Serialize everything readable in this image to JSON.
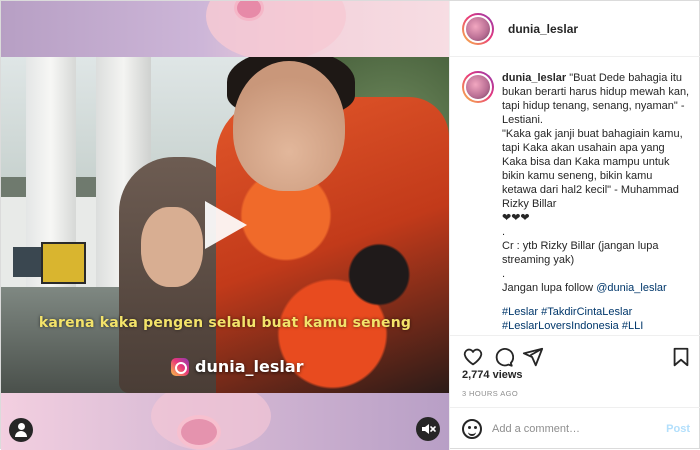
{
  "media": {
    "video_caption": "karena kaka pengen selalu buat kamu seneng",
    "watermark_handle": "dunia_leslar"
  },
  "header": {
    "username": "dunia_leslar"
  },
  "post": {
    "username": "dunia_leslar",
    "caption_lines": [
      "\"Buat Dede bahagia itu bukan berarti harus hidup mewah kan, tapi hidup tenang, senang, nyaman\" - Lestiani.",
      "\"Kaka gak janji buat bahagiain kamu, tapi Kaka akan usahain apa yang Kaka bisa dan Kaka mampu untuk bikin kamu seneng, bikin kamu ketawa dari hal2 kecil\" - Muhammad Rizky Billar",
      "❤❤❤",
      ".",
      "Cr : ytb Rizky Billar (jangan lupa streaming yak)",
      ".",
      "Jangan lupa follow"
    ],
    "mention": "@dunia_leslar",
    "hashtags": "#Leslar #TakdirCintaLeslar #LeslarLoversIndonesia #LLI #LeslarLovers #LestiBillar #LestyBillar #LeslarDansai #LeslarBerbagi #LestyK"
  },
  "stats": {
    "views": "2,774 views",
    "time_ago": "3 HOURS AGO"
  },
  "comment_box": {
    "placeholder": "Add a comment…",
    "post_label": "Post"
  },
  "icons": {
    "like": "heart-icon",
    "comment": "comment-bubble-icon",
    "share": "paper-plane-icon",
    "save": "bookmark-icon",
    "play": "play-icon",
    "user": "user-tag-icon",
    "mute": "speaker-muted-icon",
    "emoji": "smiley-icon"
  },
  "colors": {
    "caption_yellow": "#f3e36a",
    "link_blue": "#00376b",
    "post_disabled": "#b2dffc"
  }
}
